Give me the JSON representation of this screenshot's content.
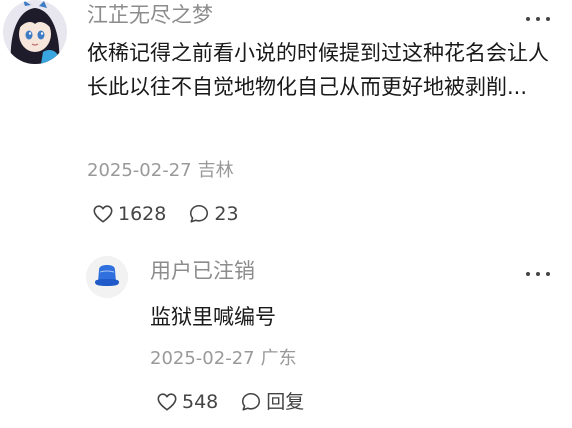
{
  "comments": [
    {
      "username": "江芷无尽之梦",
      "content": "依稀记得之前看小说的时候提到过这种花名会让人长此以往不自觉地物化自己从而更好地被剥削...",
      "date": "2025-02-27",
      "location": "吉林",
      "likes": "1628",
      "replies": "23",
      "avatar_icon": "anime-girl-avatar-icon"
    },
    {
      "username": "用户已注销",
      "content": "监狱里喊编号",
      "date": "2025-02-27",
      "location": "广东",
      "likes": "548",
      "reply_label": "回复",
      "avatar_icon": "blue-hat-avatar-icon"
    }
  ],
  "colors": {
    "secondary_text": "#8c8c8c",
    "primary_text": "#191919"
  }
}
